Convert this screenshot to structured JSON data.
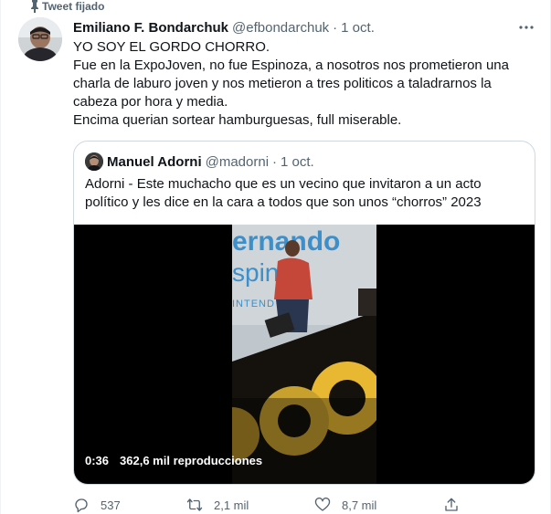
{
  "pinned": {
    "label": "Tweet fijado"
  },
  "tweet": {
    "author_name": "Emiliano F. Bondarchuk",
    "author_handle": "@efbondarchuk",
    "separator": "·",
    "date": "1 oct.",
    "more_icon": "more-horizontal-icon",
    "lines": [
      "YO SOY EL GORDO CHORRO.",
      "Fue en la ExpoJoven, no fue Espinoza, a nosotros nos prometieron una charla de laburo joven y nos metieron a tres politicos a taladrarnos la cabeza por hora y media.",
      "Encima querian sortear hamburguesas, full miserable."
    ]
  },
  "quote": {
    "author_name": "Manuel Adorni",
    "author_handle": "@madorni",
    "separator": "·",
    "date": "1 oct.",
    "text": "Adorni - Este muchacho que es un vecino que invitaron a un acto político y les dice en la cara a todos que son unos “chorros” 2023",
    "video": {
      "duration": "0:36",
      "views": "362,6 mil reproducciones",
      "banner_text": "ernando",
      "banner_sub": "spin",
      "banner_small": "INTEND"
    }
  },
  "actions": {
    "reply_count": "537",
    "retweet_count": "2,1 mil",
    "like_count": "8,7 mil"
  },
  "colors": {
    "text_primary": "#0f1419",
    "text_secondary": "#536471",
    "border": "#cfd9de"
  }
}
